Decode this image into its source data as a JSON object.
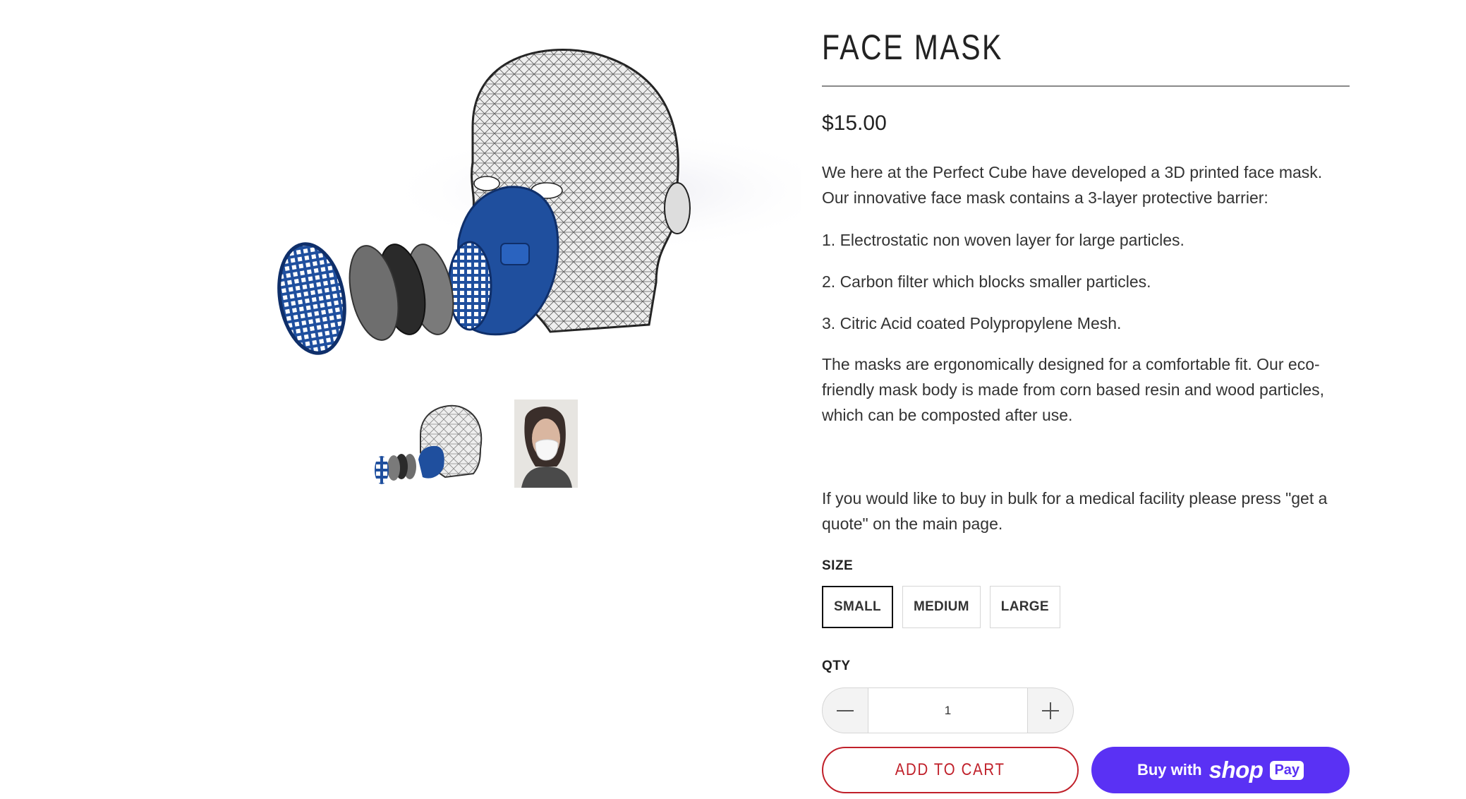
{
  "product": {
    "title": "FACE MASK",
    "price": "$15.00",
    "description": [
      "We here at the Perfect Cube have developed a 3D printed face mask. Our innovative face mask contains a 3-layer protective barrier:",
      "1. Electrostatic non woven layer for large particles.",
      "2. Carbon filter which blocks smaller particles.",
      "3. Citric Acid coated Polypropylene Mesh.",
      "The masks are ergonomically designed for a comfortable fit. Our eco-friendly mask body is made from corn based resin and wood particles, which can be composted after use.",
      "If you would like to buy in bulk for a medical facility please press \"get a quote\" on the main page."
    ]
  },
  "options": {
    "size_label": "SIZE",
    "sizes": [
      "SMALL",
      "MEDIUM",
      "LARGE"
    ],
    "selected_size": "SMALL",
    "qty_label": "QTY",
    "qty_value": "1"
  },
  "actions": {
    "add_to_cart": "ADD TO CART",
    "buy_with": "Buy with",
    "shop": "shop",
    "pay": "Pay"
  },
  "colors": {
    "accent": "#c0202a",
    "shop_pay": "#5a31f4",
    "mask_blue": "#1f4f9e"
  }
}
